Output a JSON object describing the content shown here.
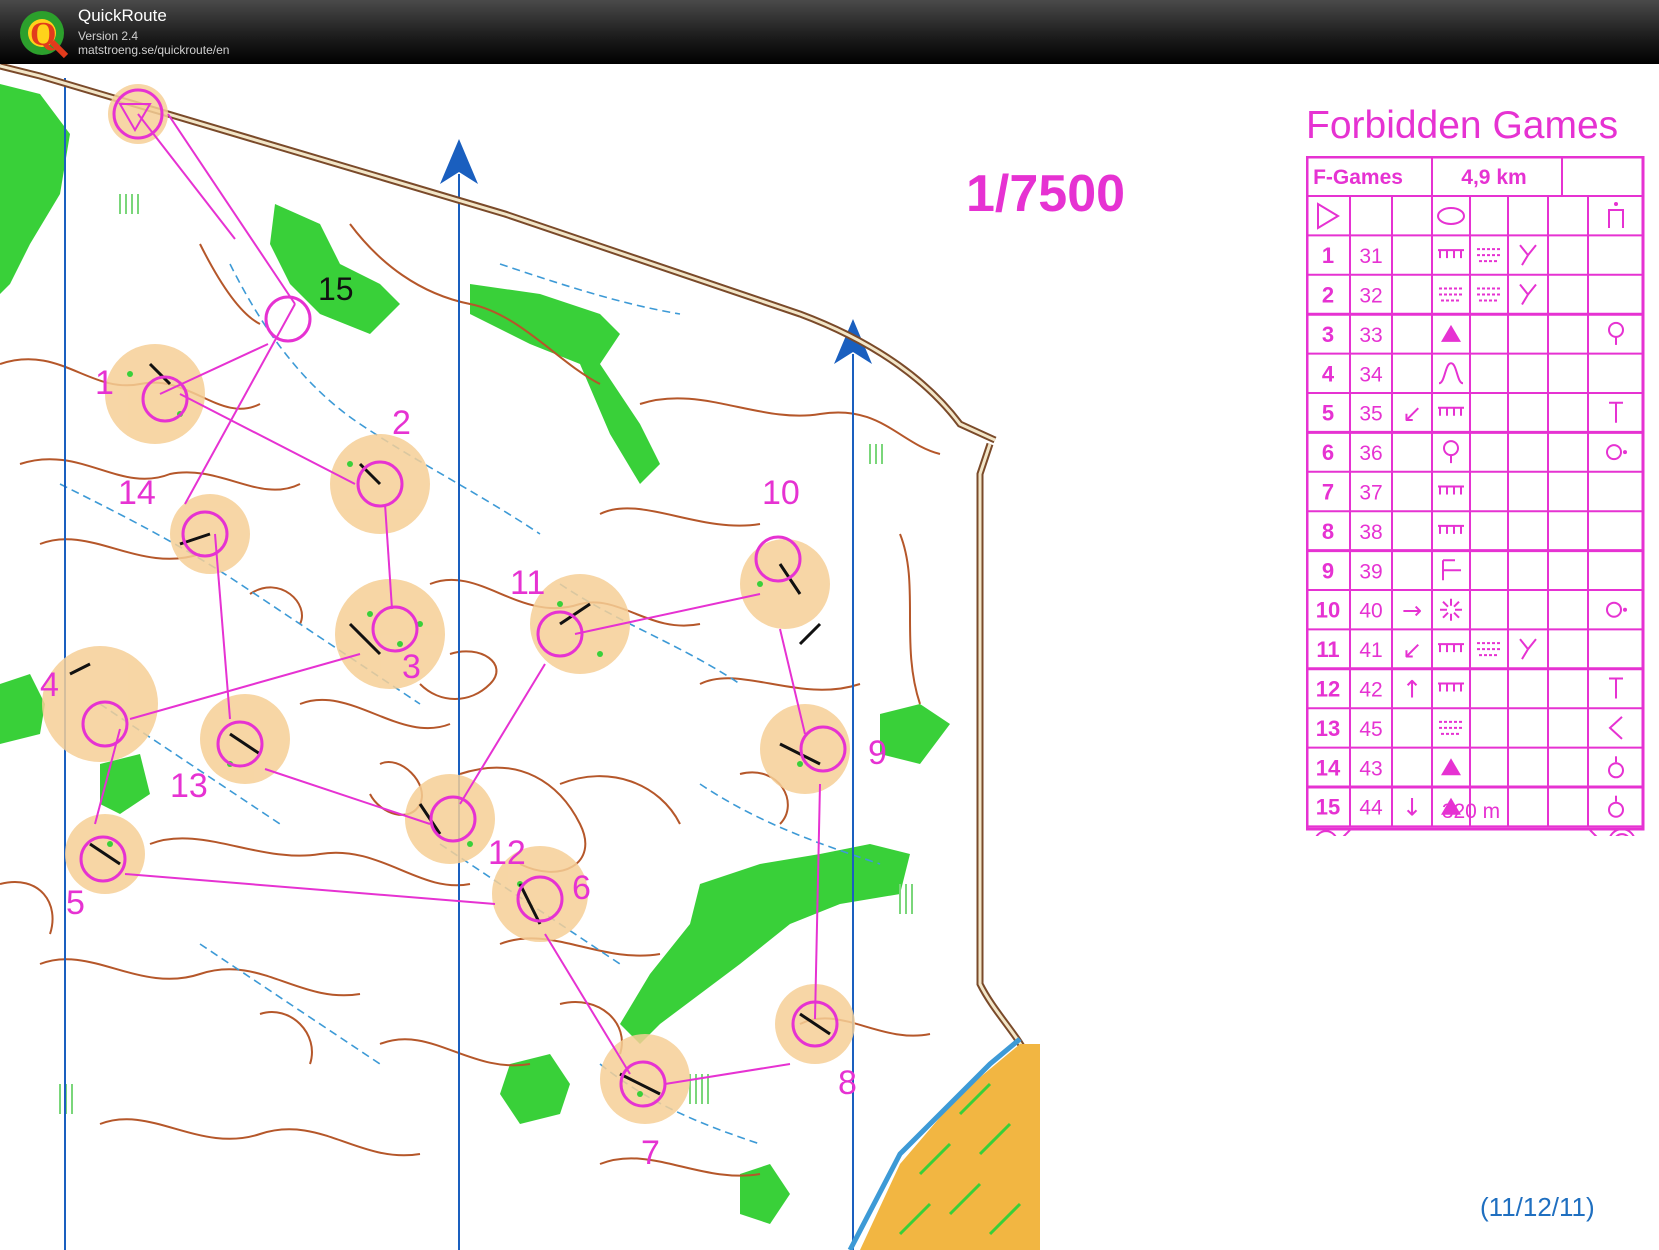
{
  "app": {
    "title": "QuickRoute",
    "version": "Version 2.4",
    "url": "matstroeng.se/quickroute/en",
    "logo_letter": "Q"
  },
  "map": {
    "event_title": "Forbidden Games",
    "scale": "1/7500",
    "date": "(11/12/11)",
    "course_color": "#e632d2",
    "north_color": "#1a5fbf",
    "contour_color": "#b5572a",
    "vegetation_color": "#39d039",
    "feature_labels": [
      {
        "text": "15",
        "color": "black"
      },
      {
        "text": "1"
      },
      {
        "text": "2"
      },
      {
        "text": "14"
      },
      {
        "text": "3"
      },
      {
        "text": "11"
      },
      {
        "text": "10"
      },
      {
        "text": "4"
      },
      {
        "text": "13"
      },
      {
        "text": "9"
      },
      {
        "text": "12"
      },
      {
        "text": "6"
      },
      {
        "text": "5"
      },
      {
        "text": "8"
      },
      {
        "text": "7"
      }
    ]
  },
  "description": {
    "course": "F-Games",
    "length": "4,9 km",
    "finish_distance": "320 m",
    "rows": [
      {
        "n": "1",
        "code": "31",
        "dir": "",
        "s1": "cliff",
        "s2": "marsh",
        "s3": "corner",
        "s4": ""
      },
      {
        "n": "2",
        "code": "32",
        "dir": "",
        "s1": "marsh",
        "s2": "marsh",
        "s3": "corner",
        "s4": ""
      },
      {
        "n": "3",
        "code": "33",
        "dir": "",
        "s1": "triangle",
        "s2": "",
        "s3": "",
        "s4": "tree"
      },
      {
        "n": "4",
        "code": "34",
        "dir": "",
        "s1": "knoll",
        "s2": "",
        "s3": "",
        "s4": ""
      },
      {
        "n": "5",
        "code": "35",
        "dir": "↙",
        "s1": "cliff",
        "s2": "",
        "s3": "",
        "s4": "foot"
      },
      {
        "n": "6",
        "code": "36",
        "dir": "",
        "s1": "tree",
        "s2": "",
        "s3": "",
        "s4": "ring"
      },
      {
        "n": "7",
        "code": "37",
        "dir": "",
        "s1": "cliff",
        "s2": "",
        "s3": "",
        "s4": ""
      },
      {
        "n": "8",
        "code": "38",
        "dir": "",
        "s1": "cliff",
        "s2": "",
        "s3": "",
        "s4": ""
      },
      {
        "n": "9",
        "code": "39",
        "dir": "",
        "s1": "junction",
        "s2": "",
        "s3": "",
        "s4": ""
      },
      {
        "n": "10",
        "code": "40",
        "dir": "→",
        "s1": "burst",
        "s2": "",
        "s3": "",
        "s4": "ring"
      },
      {
        "n": "11",
        "code": "41",
        "dir": "↙",
        "s1": "cliff",
        "s2": "marsh",
        "s3": "corner",
        "s4": ""
      },
      {
        "n": "12",
        "code": "42",
        "dir": "↑",
        "s1": "cliff",
        "s2": "",
        "s3": "",
        "s4": "foot"
      },
      {
        "n": "13",
        "code": "45",
        "dir": "",
        "s1": "marsh",
        "s2": "",
        "s3": "",
        "s4": "bracket"
      },
      {
        "n": "14",
        "code": "43",
        "dir": "",
        "s1": "triangle",
        "s2": "",
        "s3": "",
        "s4": "circle"
      },
      {
        "n": "15",
        "code": "44",
        "dir": "↓",
        "s1": "triangle",
        "s2": "",
        "s3": "",
        "s4": "circle"
      }
    ]
  }
}
